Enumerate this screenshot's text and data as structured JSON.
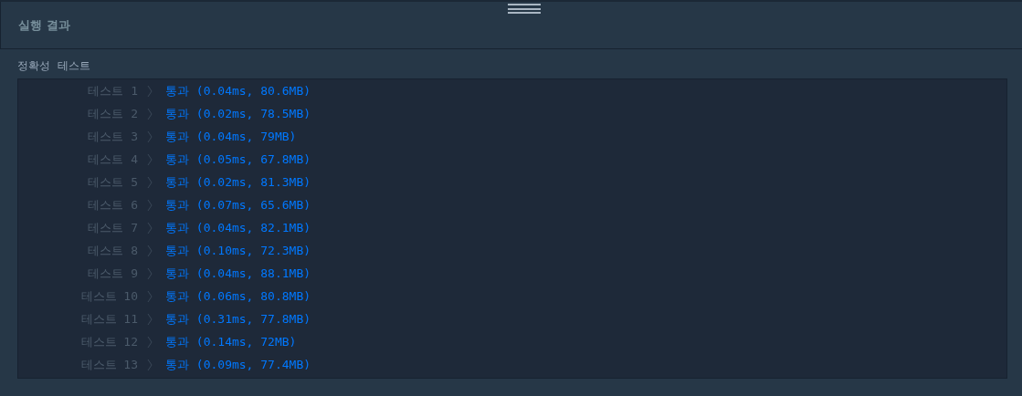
{
  "header": {
    "title": "실행 결과"
  },
  "section": {
    "label": "정확성  테스트"
  },
  "results": [
    {
      "label": "테스트 1",
      "result": "통과 (0.04ms, 80.6MB)"
    },
    {
      "label": "테스트 2",
      "result": "통과 (0.02ms, 78.5MB)"
    },
    {
      "label": "테스트 3",
      "result": "통과 (0.04ms, 79MB)"
    },
    {
      "label": "테스트 4",
      "result": "통과 (0.05ms, 67.8MB)"
    },
    {
      "label": "테스트 5",
      "result": "통과 (0.02ms, 81.3MB)"
    },
    {
      "label": "테스트 6",
      "result": "통과 (0.07ms, 65.6MB)"
    },
    {
      "label": "테스트 7",
      "result": "통과 (0.04ms, 82.1MB)"
    },
    {
      "label": "테스트 8",
      "result": "통과 (0.10ms, 72.3MB)"
    },
    {
      "label": "테스트 9",
      "result": "통과 (0.04ms, 88.1MB)"
    },
    {
      "label": "테스트 10",
      "result": "통과 (0.06ms, 80.8MB)"
    },
    {
      "label": "테스트 11",
      "result": "통과 (0.31ms, 77.8MB)"
    },
    {
      "label": "테스트 12",
      "result": "통과 (0.14ms, 72MB)"
    },
    {
      "label": "테스트 13",
      "result": "통과 (0.09ms, 77.4MB)"
    }
  ]
}
